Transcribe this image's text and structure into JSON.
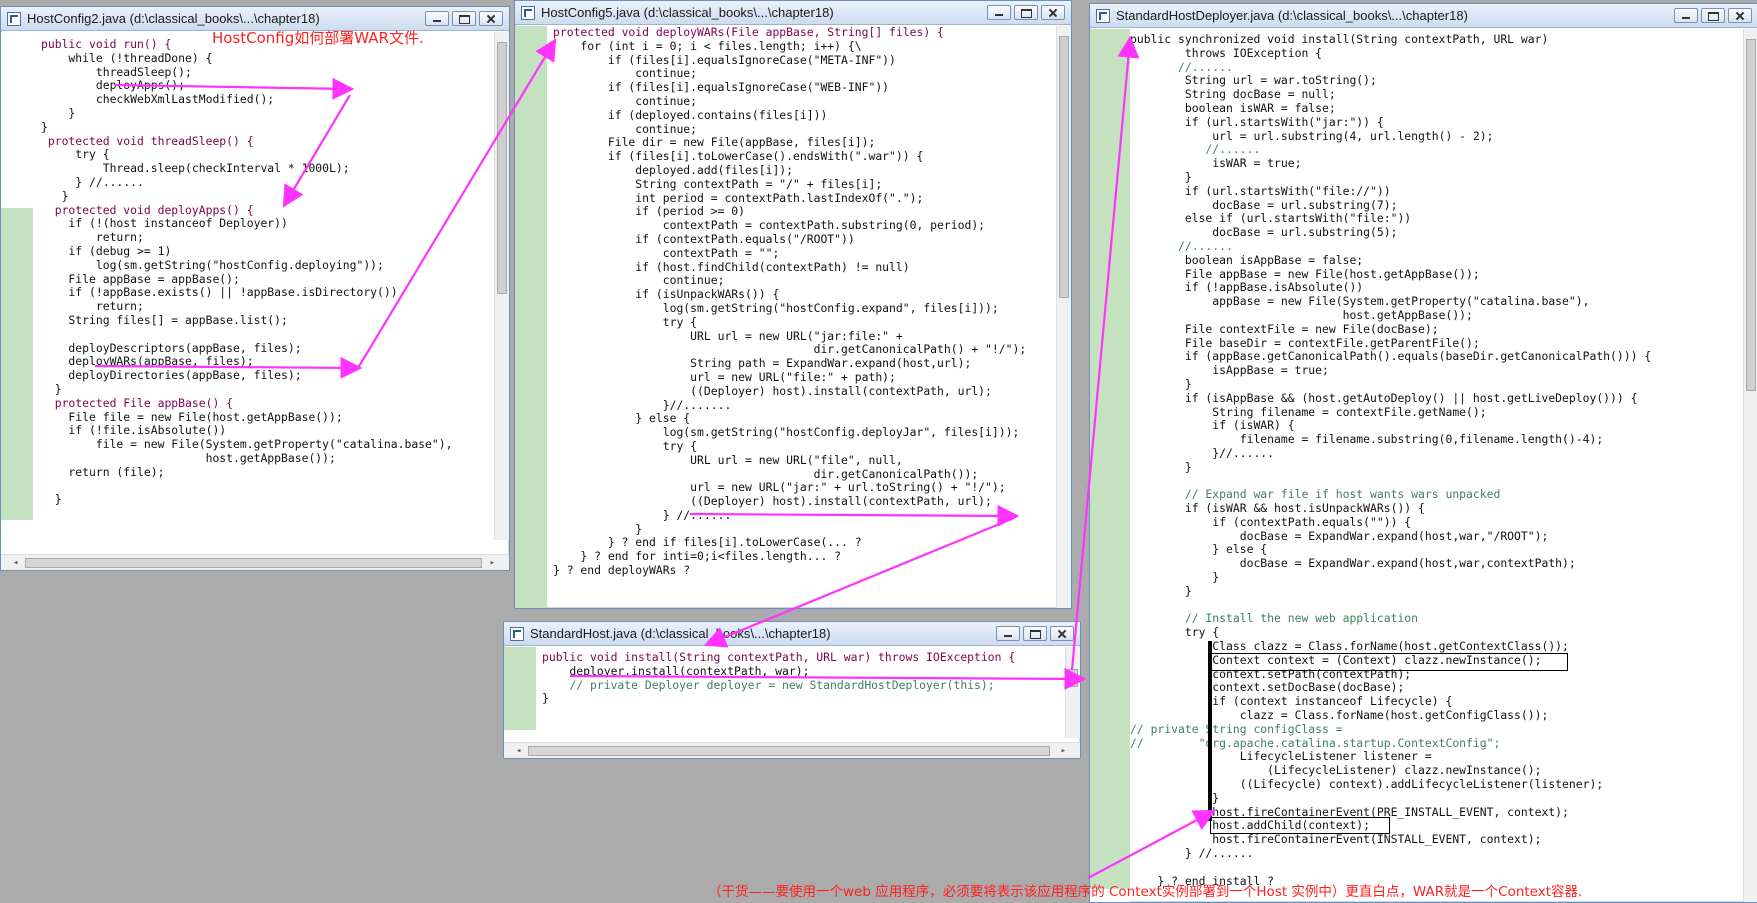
{
  "colors": {
    "desktop": "#ababab",
    "arrow": "#ff33ff",
    "annotation_text": "#ff2020",
    "gutter_highlight": "#c5e2c0"
  },
  "windows": [
    {
      "id": "hostconfig2",
      "title": "HostConfig2.java (d:\\classical_books\\...\\chapter18)",
      "lines": [
        "public void run() {",
        "    while (!threadDone) {",
        "        threadSleep();",
        "        deployApps();",
        "        checkWebXmlLastModified();",
        "    }",
        "}",
        " protected void threadSleep() {",
        "     try {",
        "         Thread.sleep(checkInterval * 1000L);",
        "     } //......",
        "   }",
        "  protected void deployApps() {",
        "    if (!(host instanceof Deployer))",
        "        return;",
        "    if (debug >= 1)",
        "        log(sm.getString(\"hostConfig.deploying\"));",
        "    File appBase = appBase();",
        "    if (!appBase.exists() || !appBase.isDirectory())",
        "        return;",
        "    String files[] = appBase.list();",
        "",
        "    deployDescriptors(appBase, files);",
        "    deployWARs(appBase, files);",
        "    deployDirectories(appBase, files);",
        "  }",
        "  protected File appBase() {",
        "    File file = new File(host.getAppBase());",
        "    if (!file.isAbsolute())",
        "        file = new File(System.getProperty(\"catalina.base\"),",
        "                        host.getAppBase());",
        "    return (file);",
        "",
        "  }"
      ]
    },
    {
      "id": "hostconfig5",
      "title": "HostConfig5.java (d:\\classical_books\\...\\chapter18)",
      "lines": [
        "protected void deployWARs(File appBase, String[] files) {",
        "    for (int i = 0; i < files.length; i++) {\\",
        "        if (files[i].equalsIgnoreCase(\"META-INF\"))",
        "            continue;",
        "        if (files[i].equalsIgnoreCase(\"WEB-INF\"))",
        "            continue;",
        "        if (deployed.contains(files[i]))",
        "            continue;",
        "        File dir = new File(appBase, files[i]);",
        "        if (files[i].toLowerCase().endsWith(\".war\")) {",
        "            deployed.add(files[i]);",
        "            String contextPath = \"/\" + files[i];",
        "            int period = contextPath.lastIndexOf(\".\");",
        "            if (period >= 0)",
        "                contextPath = contextPath.substring(0, period);",
        "            if (contextPath.equals(\"/ROOT\"))",
        "                contextPath = \"\";",
        "            if (host.findChild(contextPath) != null)",
        "                continue;",
        "            if (isUnpackWARs()) {",
        "                log(sm.getString(\"hostConfig.expand\", files[i]));",
        "                try {",
        "                    URL url = new URL(\"jar:file:\" +",
        "                                      dir.getCanonicalPath() + \"!/\");",
        "                    String path = ExpandWar.expand(host,url);",
        "                    url = new URL(\"file:\" + path);",
        "                    ((Deployer) host).install(contextPath, url);",
        "                }//.......",
        "            } else {",
        "                log(sm.getString(\"hostConfig.deployJar\", files[i]));",
        "                try {",
        "                    URL url = new URL(\"file\", null,",
        "                                      dir.getCanonicalPath());",
        "                    url = new URL(\"jar:\" + url.toString() + \"!/\");",
        "                    ((Deployer) host).install(contextPath, url);",
        "                } //......",
        "            }",
        "        } ? end if files[i].toLowerCase(... ?",
        "    } ? end for inti=0;i<files.length... ?",
        "} ? end deployWARs ?"
      ]
    },
    {
      "id": "standardhost",
      "title": "StandardHost.java (d:\\classical_books\\...\\chapter18)",
      "lines": [
        "public void install(String contextPath, URL war) throws IOException {",
        "    deployer.install(contextPath, war);",
        "    // private Deployer deployer = new StandardHostDeployer(this);",
        "}"
      ]
    },
    {
      "id": "standardhostdeployer",
      "title": "StandardHostDeployer.java (d:\\classical_books\\...\\chapter18)",
      "lines": [
        "public synchronized void install(String contextPath, URL war)",
        "        throws IOException {",
        "       //......",
        "        String url = war.toString();",
        "        String docBase = null;",
        "        boolean isWAR = false;",
        "        if (url.startsWith(\"jar:\")) {",
        "            url = url.substring(4, url.length() - 2);",
        "           //......",
        "            isWAR = true;",
        "        }",
        "        if (url.startsWith(\"file://\"))",
        "            docBase = url.substring(7);",
        "        else if (url.startsWith(\"file:\"))",
        "            docBase = url.substring(5);",
        "       //......",
        "        boolean isAppBase = false;",
        "        File appBase = new File(host.getAppBase());",
        "        if (!appBase.isAbsolute())",
        "            appBase = new File(System.getProperty(\"catalina.base\"),",
        "                               host.getAppBase());",
        "        File contextFile = new File(docBase);",
        "        File baseDir = contextFile.getParentFile();",
        "        if (appBase.getCanonicalPath().equals(baseDir.getCanonicalPath())) {",
        "            isAppBase = true;",
        "        }",
        "        if (isAppBase && (host.getAutoDeploy() || host.getLiveDeploy())) {",
        "            String filename = contextFile.getName();",
        "            if (isWAR) {",
        "                filename = filename.substring(0,filename.length()-4);",
        "            }//......",
        "        }",
        "",
        "        // Expand war file if host wants wars unpacked",
        "        if (isWAR && host.isUnpackWARs()) {",
        "            if (contextPath.equals(\"\")) {",
        "                docBase = ExpandWar.expand(host,war,\"/ROOT\");",
        "            } else {",
        "                docBase = ExpandWar.expand(host,war,contextPath);",
        "            }",
        "        }",
        "",
        "        // Install the new web application",
        "        try {",
        "            Class clazz = Class.forName(host.getContextClass());",
        "            Context context = (Context) clazz.newInstance();",
        "            context.setPath(contextPath);",
        "            context.setDocBase(docBase);",
        "            if (context instanceof Lifecycle) {",
        "                clazz = Class.forName(host.getConfigClass());",
        "// private String configClass =",
        "//        \"org.apache.catalina.startup.ContextConfig\";",
        "                LifecycleListener listener =",
        "                    (LifecycleListener) clazz.newInstance();",
        "                ((Lifecycle) context).addLifecycleListener(listener);",
        "            }",
        "            host.fireContainerEvent(PRE_INSTALL_EVENT, context);",
        "            host.addChild(context);",
        "            host.fireContainerEvent(INSTALL_EVENT, context);",
        "        } //......",
        "",
        "    } ? end install ?"
      ]
    }
  ],
  "annotations": {
    "hostconfig_title": "HostConfig如何部署WAR文件.",
    "bottom_note": "（干货——要使用一个web 应用程序，必须要将表示该应用程序的 Context实例部署到一个Host 实例中）更直白点，WAR就是一个Context容器."
  }
}
